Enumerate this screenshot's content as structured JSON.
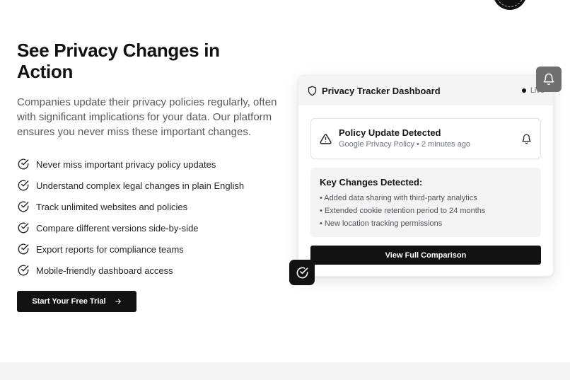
{
  "hero": {
    "title": "See Privacy Changes in Action",
    "description": "Companies update their privacy policies regularly, often with significant implications for your data. Our platform ensures you never miss these important changes.",
    "features": [
      "Never miss important privacy policy updates",
      "Understand complex legal changes in plain English",
      "Track unlimited websites and policies",
      "Compare different versions side-by-side",
      "Export reports for compliance teams",
      "Mobile-friendly dashboard access"
    ],
    "cta_label": "Start Your Free Trial"
  },
  "dashboard": {
    "title": "Privacy Tracker Dashboard",
    "status": "Live",
    "alert": {
      "title": "Policy Update Detected",
      "subtitle": "Google Privacy Policy • 2 minutes ago"
    },
    "changes": {
      "title": "Key Changes Detected:",
      "items": [
        "• Added data sharing with third-party analytics",
        "• Extended cookie retention period to 24 months",
        "• New location tracking permissions"
      ]
    },
    "compare_label": "View Full Comparison"
  },
  "icons": {
    "feature": "check-circle-icon",
    "cta": "arrow-right-icon",
    "header": "shield-icon",
    "alert": "warning-triangle-icon",
    "alert_action": "bell-icon",
    "floating_top": "bell-icon",
    "floating_bottom": "check-circle-icon"
  },
  "colors": {
    "primary": "#121212",
    "muted_text": "#555a61",
    "card_header": "#f4f4f5",
    "panel": "#f3f3f4",
    "floating_gray": "#6f6f6f"
  }
}
